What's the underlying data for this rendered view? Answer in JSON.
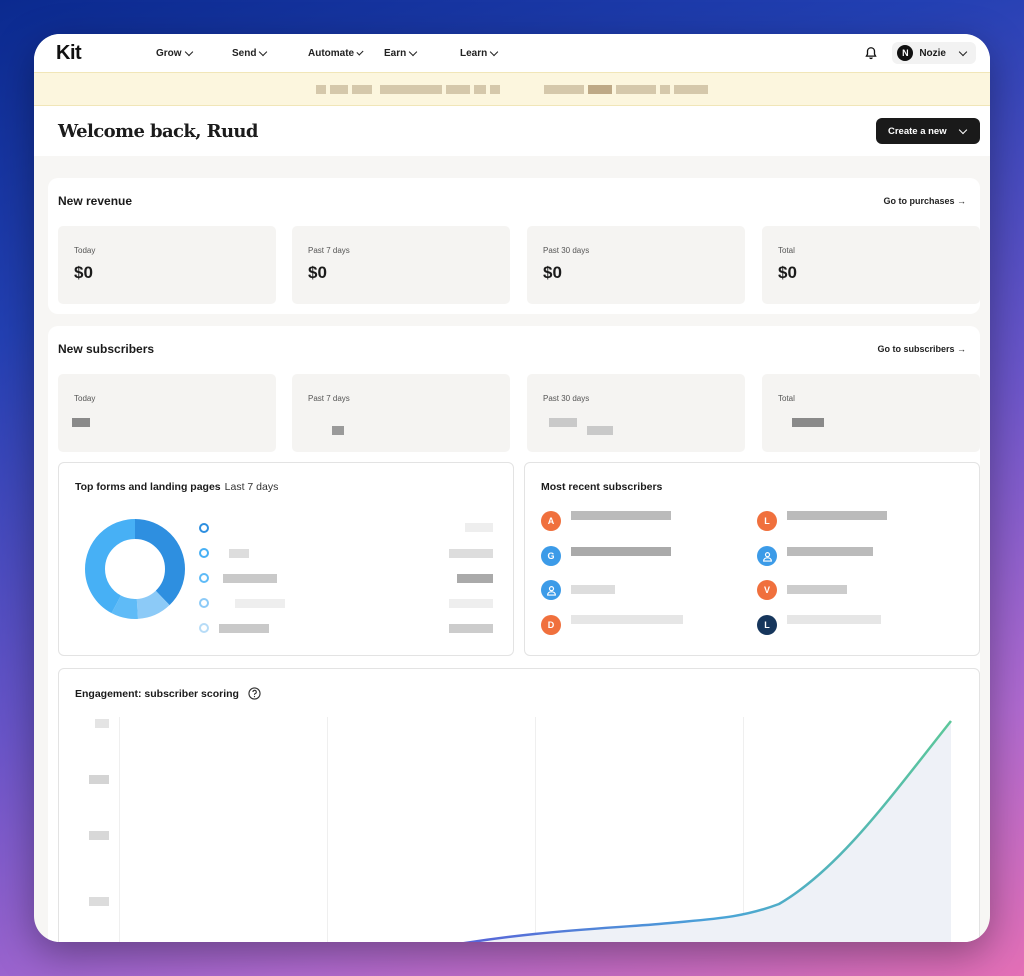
{
  "app": {
    "logo": "Kit"
  },
  "nav": {
    "items": [
      {
        "label": "Grow"
      },
      {
        "label": "Send"
      },
      {
        "label": "Automate"
      },
      {
        "label": "Earn"
      },
      {
        "label": "Learn"
      }
    ],
    "user": {
      "initial": "N",
      "name": "Nozie"
    }
  },
  "header": {
    "welcome": "Welcome back, Ruud",
    "create_button": "Create a new"
  },
  "revenue": {
    "title": "New revenue",
    "link": "Go to purchases →",
    "stats": [
      {
        "label": "Today",
        "value": "$0"
      },
      {
        "label": "Past 7 days",
        "value": "$0"
      },
      {
        "label": "Past 30 days",
        "value": "$0"
      },
      {
        "label": "Total",
        "value": "$0"
      }
    ]
  },
  "subscribers": {
    "title": "New subscribers",
    "link": "Go to subscribers →",
    "stats": [
      {
        "label": "Today"
      },
      {
        "label": "Past 7 days"
      },
      {
        "label": "Past 30 days"
      },
      {
        "label": "Total"
      }
    ]
  },
  "top_forms": {
    "title": "Top forms and landing pages",
    "period": "Last 7 days",
    "donut_colors": [
      "#2e8fe0",
      "#47b0f5",
      "#5fbbf7",
      "#8ccaf7",
      "#b7dcf7"
    ]
  },
  "recent": {
    "title": "Most recent subscribers",
    "avatars": [
      {
        "initial": "A",
        "color": "#f0703d"
      },
      {
        "initial": "L",
        "color": "#f0703d"
      },
      {
        "initial": "G",
        "color": "#3c9be8"
      },
      {
        "initial": "",
        "color": "#3c9be8",
        "icon": "person-icon"
      },
      {
        "initial": "",
        "color": "#3c9be8",
        "icon": "person-icon"
      },
      {
        "initial": "V",
        "color": "#f0703d"
      },
      {
        "initial": "D",
        "color": "#f0703d"
      },
      {
        "initial": "L",
        "color": "#16365c"
      }
    ]
  },
  "engagement": {
    "title": "Engagement: subscriber scoring",
    "help_icon": "question-circle-icon"
  }
}
